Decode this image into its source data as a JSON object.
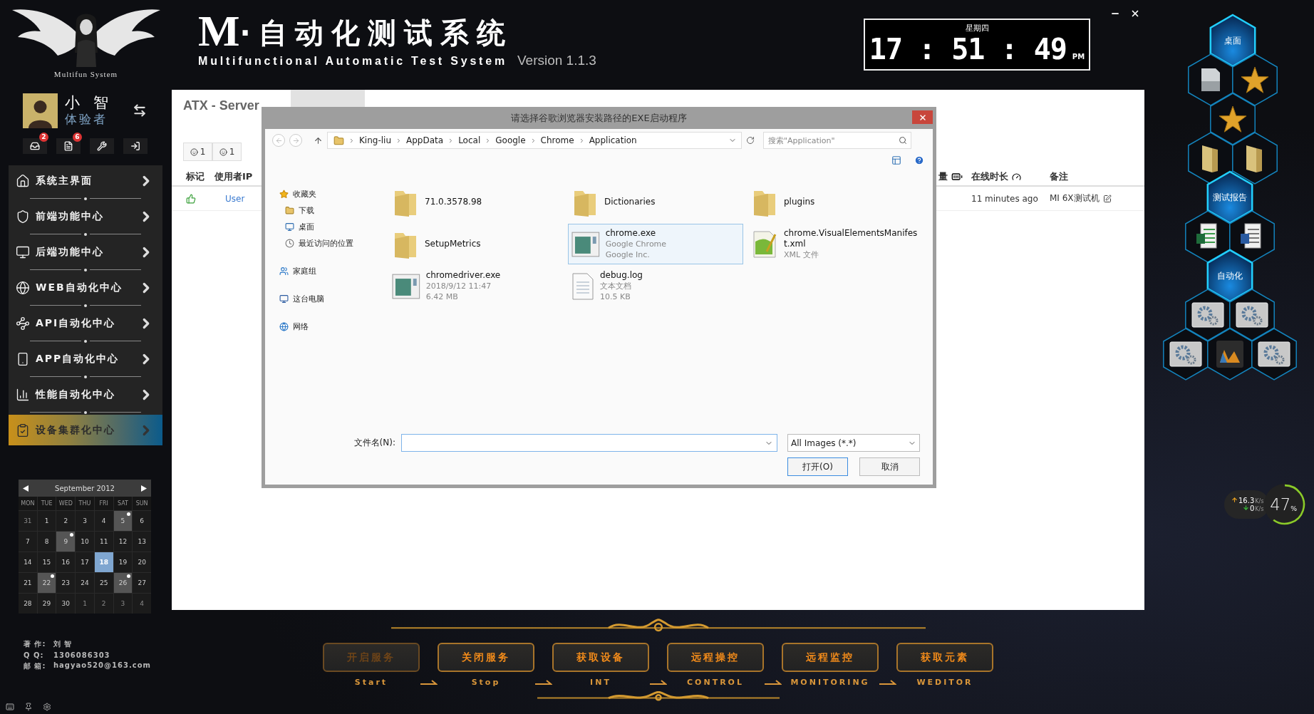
{
  "header": {
    "logo_caption": "Multifun System",
    "logo_letter": "M",
    "title": "·自动化测试系统",
    "subtitle": "Multifunctional Automatic Test System",
    "version": "Version 1.1.3"
  },
  "clock": {
    "weekday": "星期四",
    "time": "17 : 51 : 49",
    "meridiem": "PM"
  },
  "user": {
    "name": "小 智",
    "role": "体验者"
  },
  "quick_icons": [
    {
      "kind": "inbox",
      "badge": "2"
    },
    {
      "kind": "notes",
      "badge": "6"
    },
    {
      "kind": "tools"
    },
    {
      "kind": "exit"
    }
  ],
  "menu": [
    {
      "label": "系统主界面",
      "selected": false
    },
    {
      "label": "前端功能中心",
      "selected": false
    },
    {
      "label": "后端功能中心",
      "selected": false
    },
    {
      "label": "WEB自动化中心",
      "selected": false
    },
    {
      "label": "API自动化中心",
      "selected": false
    },
    {
      "label": "APP自动化中心",
      "selected": false
    },
    {
      "label": "性能自动化中心",
      "selected": false
    },
    {
      "label": "设备集群化中心",
      "selected": true
    }
  ],
  "calendar": {
    "month": "September 2012",
    "weekdays": [
      "MON",
      "TUE",
      "WED",
      "THU",
      "FRI",
      "SAT",
      "SUN"
    ],
    "days": [
      {
        "day": "31",
        "kind": "other",
        "marked": false,
        "selected": false
      },
      {
        "day": "1",
        "kind": "current",
        "marked": false,
        "selected": false
      },
      {
        "day": "2",
        "kind": "current",
        "marked": false,
        "selected": false
      },
      {
        "day": "3",
        "kind": "current",
        "marked": false,
        "selected": false
      },
      {
        "day": "4",
        "kind": "current",
        "marked": false,
        "selected": false
      },
      {
        "day": "5",
        "kind": "current",
        "marked": true,
        "selected": false
      },
      {
        "day": "6",
        "kind": "current",
        "marked": false,
        "selected": false
      },
      {
        "day": "7",
        "kind": "current",
        "marked": false,
        "selected": false
      },
      {
        "day": "8",
        "kind": "current",
        "marked": false,
        "selected": false
      },
      {
        "day": "9",
        "kind": "current",
        "marked": true,
        "selected": false
      },
      {
        "day": "10",
        "kind": "current",
        "marked": false,
        "selected": false
      },
      {
        "day": "11",
        "kind": "current",
        "marked": false,
        "selected": false
      },
      {
        "day": "12",
        "kind": "current",
        "marked": false,
        "selected": false
      },
      {
        "day": "13",
        "kind": "current",
        "marked": false,
        "selected": false
      },
      {
        "day": "14",
        "kind": "current",
        "marked": false,
        "selected": false
      },
      {
        "day": "15",
        "kind": "current",
        "marked": false,
        "selected": false
      },
      {
        "day": "16",
        "kind": "current",
        "marked": false,
        "selected": false
      },
      {
        "day": "17",
        "kind": "current",
        "marked": false,
        "selected": false
      },
      {
        "day": "18",
        "kind": "current",
        "marked": false,
        "selected": true
      },
      {
        "day": "19",
        "kind": "current",
        "marked": false,
        "selected": false
      },
      {
        "day": "20",
        "kind": "current",
        "marked": false,
        "selected": false
      },
      {
        "day": "21",
        "kind": "current",
        "marked": false,
        "selected": false
      },
      {
        "day": "22",
        "kind": "current",
        "marked": true,
        "selected": false
      },
      {
        "day": "23",
        "kind": "current",
        "marked": false,
        "selected": false
      },
      {
        "day": "24",
        "kind": "current",
        "marked": false,
        "selected": false
      },
      {
        "day": "25",
        "kind": "current",
        "marked": false,
        "selected": false
      },
      {
        "day": "26",
        "kind": "current",
        "marked": true,
        "selected": false
      },
      {
        "day": "27",
        "kind": "current",
        "marked": false,
        "selected": false
      },
      {
        "day": "28",
        "kind": "current",
        "marked": false,
        "selected": false
      },
      {
        "day": "29",
        "kind": "current",
        "marked": false,
        "selected": false
      },
      {
        "day": "30",
        "kind": "current",
        "marked": false,
        "selected": false
      },
      {
        "day": "1",
        "kind": "other",
        "marked": false,
        "selected": false
      },
      {
        "day": "2",
        "kind": "other",
        "marked": false,
        "selected": false
      },
      {
        "day": "3",
        "kind": "other",
        "marked": false,
        "selected": false
      },
      {
        "day": "4",
        "kind": "other",
        "marked": false,
        "selected": false
      }
    ]
  },
  "author": [
    {
      "label": "著 作:",
      "value": "刘 智"
    },
    {
      "label": "Q Q:",
      "value": "1306086303"
    },
    {
      "label": "邮 箱:",
      "value": "hagyao520@163.com"
    }
  ],
  "server": {
    "title": "ATX - Server",
    "filters": [
      {
        "count": "1"
      },
      {
        "count": "1"
      }
    ],
    "columns": [
      "标记",
      "使用者IP",
      "量",
      "在线时长",
      "备注"
    ],
    "row": {
      "user": "User",
      "online": "11 minutes ago",
      "note": "MI 6X测试机"
    }
  },
  "dialog": {
    "title": "请选择谷歌浏览器安装路径的EXE启动程序",
    "path": [
      "King-liu",
      "AppData",
      "Local",
      "Google",
      "Chrome",
      "Application"
    ],
    "search_placeholder": "搜索\"Application\"",
    "nav": [
      {
        "label": "收藏夹",
        "kind": "favorites",
        "children": [
          {
            "label": "下载",
            "kind": "downloads"
          },
          {
            "label": "桌面",
            "kind": "desktop"
          },
          {
            "label": "最近访问的位置",
            "kind": "recent"
          }
        ]
      },
      {
        "label": "家庭组",
        "kind": "homegroup"
      },
      {
        "label": "这台电脑",
        "kind": "computer"
      },
      {
        "label": "网络",
        "kind": "network"
      }
    ],
    "files": [
      {
        "name": "71.0.3578.98",
        "kind": "folder",
        "selected": false
      },
      {
        "name": "Dictionaries",
        "kind": "folder",
        "selected": false
      },
      {
        "name": "plugins",
        "kind": "folder",
        "selected": false
      },
      {
        "name": "SetupMetrics",
        "kind": "folder",
        "selected": false
      },
      {
        "name": "chrome.exe",
        "kind": "exe",
        "details": [
          "Google Chrome",
          "Google Inc."
        ],
        "selected": true
      },
      {
        "name": "chrome.VisualElementsManifest.xml",
        "kind": "xml",
        "details": [
          "XML 文件"
        ],
        "selected": false
      },
      {
        "name": "chromedriver.exe",
        "kind": "exe",
        "details": [
          "2018/9/12 11:47",
          "6.42 MB"
        ],
        "selected": false
      },
      {
        "name": "debug.log",
        "kind": "text",
        "details": [
          "文本文档",
          "10.5 KB"
        ],
        "selected": false
      }
    ],
    "file_name_label": "文件名(N):",
    "file_type": "All Images (*.*)",
    "buttons": [
      {
        "label": "打开(O)",
        "kind": "primary"
      },
      {
        "label": "取消",
        "kind": "normal"
      }
    ]
  },
  "hex_menu": [
    {
      "kind": "label",
      "label": "桌面"
    },
    {
      "kind": "document"
    },
    {
      "kind": "star"
    },
    {
      "kind": "star"
    },
    {
      "kind": "folder"
    },
    {
      "kind": "folder"
    },
    {
      "kind": "label",
      "label": "测试报告"
    },
    {
      "kind": "spreadsheet"
    },
    {
      "kind": "word"
    },
    {
      "kind": "label",
      "label": "自动化"
    },
    {
      "kind": "gear"
    },
    {
      "kind": "gear"
    },
    {
      "kind": "gear"
    },
    {
      "kind": "chart"
    },
    {
      "kind": "gear"
    }
  ],
  "network": {
    "upload": "16.3",
    "upload_unit": "K/s",
    "download": "0",
    "download_unit": "K/s",
    "percent": "47",
    "percent_sign": "%"
  },
  "actions": [
    {
      "label": "开启服务",
      "caption": "Start",
      "disabled": true
    },
    {
      "label": "关闭服务",
      "caption": "Stop",
      "disabled": false
    },
    {
      "label": "获取设备",
      "caption": "INT",
      "disabled": false
    },
    {
      "label": "远程操控",
      "caption": "CONTROL",
      "disabled": false
    },
    {
      "label": "远程监控",
      "caption": "MONITORING",
      "disabled": false
    },
    {
      "label": "获取元素",
      "caption": "WEDITOR",
      "disabled": false
    }
  ]
}
